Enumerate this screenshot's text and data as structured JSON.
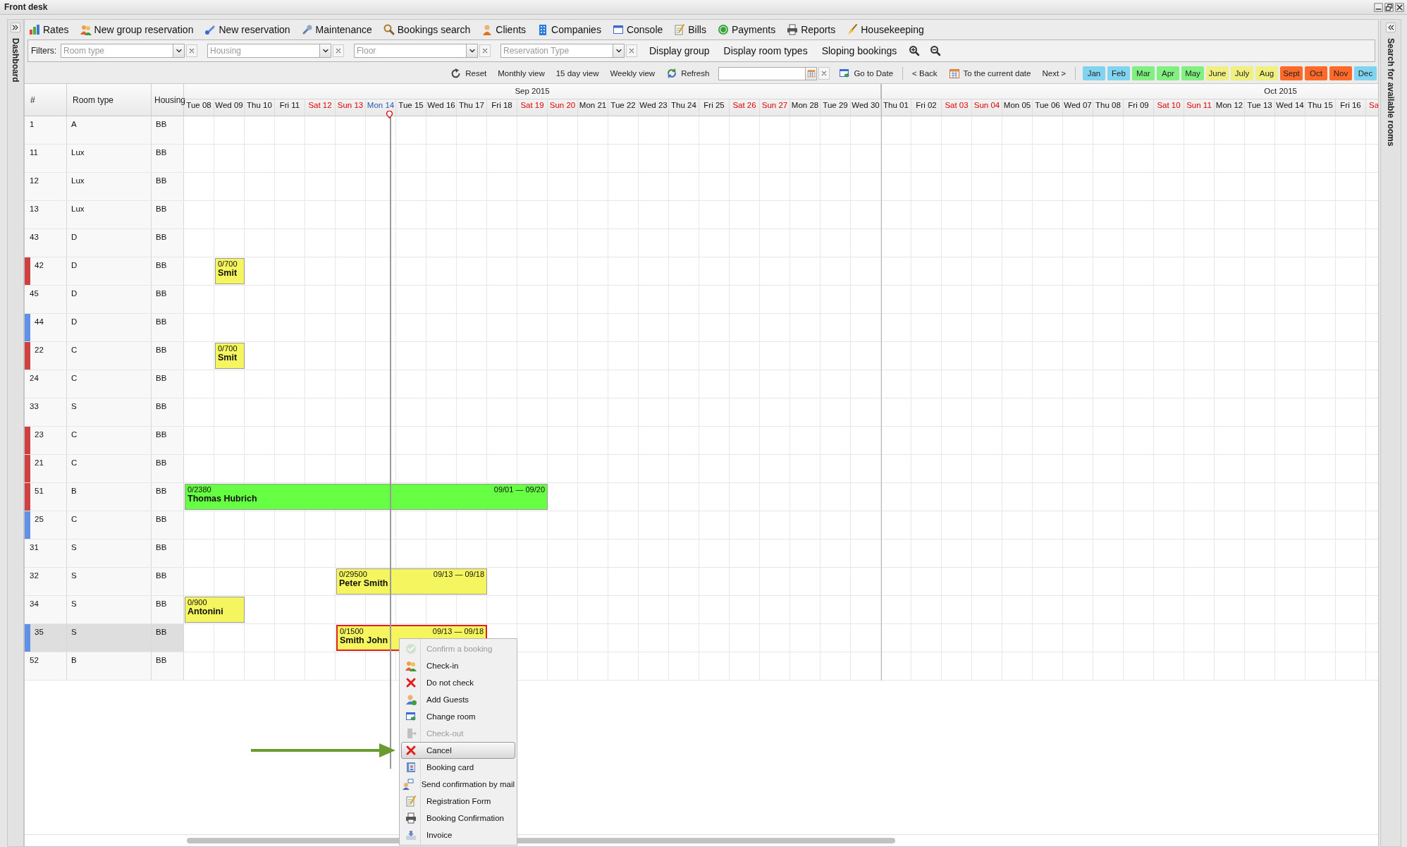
{
  "window": {
    "title": "Front desk"
  },
  "sidebars": {
    "left": {
      "label": "Dashboard"
    },
    "right": {
      "label": "Search for available rooms"
    }
  },
  "toolbar": [
    {
      "label": "Rates"
    },
    {
      "label": "New group reservation"
    },
    {
      "label": "New reservation"
    },
    {
      "label": "Maintenance"
    },
    {
      "label": "Bookings search"
    },
    {
      "label": "Clients"
    },
    {
      "label": "Companies"
    },
    {
      "label": "Console"
    },
    {
      "label": "Bills"
    },
    {
      "label": "Payments"
    },
    {
      "label": "Reports"
    },
    {
      "label": "Housekeeping"
    }
  ],
  "filters": {
    "label": "Filters:",
    "fields": [
      {
        "placeholder": "Room type"
      },
      {
        "placeholder": "Housing"
      },
      {
        "placeholder": "Floor"
      },
      {
        "placeholder": "Reservation Type"
      }
    ],
    "buttons": [
      "Display group",
      "Display room types",
      "Sloping bookings"
    ]
  },
  "nav": {
    "view_buttons": [
      "Reset",
      "Monthly view",
      "15 day view",
      "Weekly view",
      "Refresh"
    ],
    "go_to_date": "Go to Date",
    "back": "< Back",
    "current_date": "To the current date",
    "next": "Next >",
    "months": [
      {
        "label": "Jan",
        "color": "#80d4f0"
      },
      {
        "label": "Feb",
        "color": "#80d4f0"
      },
      {
        "label": "Mar",
        "color": "#80f080"
      },
      {
        "label": "Apr",
        "color": "#80f080"
      },
      {
        "label": "May",
        "color": "#80f080"
      },
      {
        "label": "June",
        "color": "#f0f080"
      },
      {
        "label": "July",
        "color": "#f0f080"
      },
      {
        "label": "Aug",
        "color": "#f0f080"
      },
      {
        "label": "Sept",
        "color": "#ff6a2a"
      },
      {
        "label": "Oct",
        "color": "#ff6a2a"
      },
      {
        "label": "Nov",
        "color": "#ff6a2a"
      },
      {
        "label": "Dec",
        "color": "#80d4f0"
      }
    ]
  },
  "grid": {
    "columns": [
      "#",
      "Room type",
      "Housing"
    ],
    "months": [
      {
        "label": "Sep 2015",
        "days": [
          {
            "label": "Tue 08",
            "kind": "weekday"
          },
          {
            "label": "Wed 09",
            "kind": "weekday"
          },
          {
            "label": "Thu 10",
            "kind": "weekday"
          },
          {
            "label": "Fri 11",
            "kind": "weekday"
          },
          {
            "label": "Sat 12",
            "kind": "weekend"
          },
          {
            "label": "Sun 13",
            "kind": "weekend"
          },
          {
            "label": "Mon 14",
            "kind": "today"
          },
          {
            "label": "Tue 15",
            "kind": "weekday"
          },
          {
            "label": "Wed 16",
            "kind": "weekday"
          },
          {
            "label": "Thu 17",
            "kind": "weekday"
          },
          {
            "label": "Fri 18",
            "kind": "weekday"
          },
          {
            "label": "Sat 19",
            "kind": "weekend"
          },
          {
            "label": "Sun 20",
            "kind": "weekend"
          },
          {
            "label": "Mon 21",
            "kind": "weekday"
          },
          {
            "label": "Tue 22",
            "kind": "weekday"
          },
          {
            "label": "Wed 23",
            "kind": "weekday"
          },
          {
            "label": "Thu 24",
            "kind": "weekday"
          },
          {
            "label": "Fri 25",
            "kind": "weekday"
          },
          {
            "label": "Sat 26",
            "kind": "weekend"
          },
          {
            "label": "Sun 27",
            "kind": "weekend"
          },
          {
            "label": "Mon 28",
            "kind": "weekday"
          },
          {
            "label": "Tue 29",
            "kind": "weekday"
          },
          {
            "label": "Wed 30",
            "kind": "weekday"
          }
        ]
      },
      {
        "label": "Oct 2015",
        "days": [
          {
            "label": "Thu 01",
            "kind": "weekday"
          },
          {
            "label": "Fri 02",
            "kind": "weekday"
          },
          {
            "label": "Sat 03",
            "kind": "weekend"
          },
          {
            "label": "Sun 04",
            "kind": "weekend"
          },
          {
            "label": "Mon 05",
            "kind": "weekday"
          },
          {
            "label": "Tue 06",
            "kind": "weekday"
          },
          {
            "label": "Wed 07",
            "kind": "weekday"
          },
          {
            "label": "Thu 08",
            "kind": "weekday"
          },
          {
            "label": "Fri 09",
            "kind": "weekday"
          },
          {
            "label": "Sat 10",
            "kind": "weekend"
          },
          {
            "label": "Sun 11",
            "kind": "weekend"
          },
          {
            "label": "Mon 12",
            "kind": "weekday"
          },
          {
            "label": "Tue 13",
            "kind": "weekday"
          },
          {
            "label": "Wed 14",
            "kind": "weekday"
          },
          {
            "label": "Thu 15",
            "kind": "weekday"
          },
          {
            "label": "Fri 16",
            "kind": "weekday"
          },
          {
            "label": "Sa",
            "kind": "weekend"
          }
        ]
      }
    ],
    "rows": [
      {
        "number": "1",
        "room_type": "A",
        "housing": "BB",
        "selected": false
      },
      {
        "number": "11",
        "room_type": "Lux",
        "housing": "BB",
        "selected": false
      },
      {
        "number": "12",
        "room_type": "Lux",
        "housing": "BB",
        "selected": false
      },
      {
        "number": "13",
        "room_type": "Lux",
        "housing": "BB",
        "selected": false
      },
      {
        "number": "43",
        "room_type": "D",
        "housing": "BB",
        "selected": false
      },
      {
        "number": "42",
        "room_type": "D",
        "housing": "BB",
        "color": "#d04040",
        "selected": false,
        "bookings": [
          {
            "amount": "0/700",
            "guest": "Smit",
            "color": "#f5f560",
            "selected": false
          }
        ]
      },
      {
        "number": "45",
        "room_type": "D",
        "housing": "BB",
        "selected": false
      },
      {
        "number": "44",
        "room_type": "D",
        "housing": "BB",
        "color": "#6090e8",
        "selected": false
      },
      {
        "number": "22",
        "room_type": "C",
        "housing": "BB",
        "color": "#d04040",
        "selected": false,
        "bookings": [
          {
            "amount": "0/700",
            "guest": "Smit",
            "color": "#f5f560",
            "selected": false
          }
        ]
      },
      {
        "number": "24",
        "room_type": "C",
        "housing": "BB",
        "selected": false
      },
      {
        "number": "33",
        "room_type": "S",
        "housing": "BB",
        "selected": false
      },
      {
        "number": "23",
        "room_type": "C",
        "housing": "BB",
        "color": "#d04040",
        "selected": false
      },
      {
        "number": "21",
        "room_type": "C",
        "housing": "BB",
        "color": "#d04040",
        "selected": false
      },
      {
        "number": "51",
        "room_type": "B",
        "housing": "BB",
        "color": "#d04040",
        "selected": false,
        "bookings": [
          {
            "amount": "0/2380",
            "guest": "Thomas Hubrich",
            "dates": "09/01 — 09/20",
            "color": "#66ff44",
            "selected": false
          }
        ]
      },
      {
        "number": "25",
        "room_type": "C",
        "housing": "BB",
        "color": "#6090e8",
        "selected": false
      },
      {
        "number": "31",
        "room_type": "S",
        "housing": "BB",
        "selected": false
      },
      {
        "number": "32",
        "room_type": "S",
        "housing": "BB",
        "selected": false,
        "bookings": [
          {
            "amount": "0/29500",
            "guest": "Peter Smith",
            "dates": "09/13 — 09/18",
            "color": "#f5f560",
            "selected": false
          }
        ]
      },
      {
        "number": "34",
        "room_type": "S",
        "housing": "BB",
        "selected": false,
        "bookings": [
          {
            "amount": "0/900",
            "guest": "Antonini",
            "color": "#f5f560",
            "selected": false
          }
        ]
      },
      {
        "number": "35",
        "room_type": "S",
        "housing": "BB",
        "color": "#6090e8",
        "selected": true,
        "bookings": [
          {
            "amount": "0/1500",
            "guest": "Smith John",
            "dates": "09/13 — 09/18",
            "color": "#f5f560",
            "selected": true
          }
        ]
      },
      {
        "number": "52",
        "room_type": "B",
        "housing": "BB",
        "selected": false
      }
    ]
  },
  "context_menu": {
    "items": [
      {
        "label": "Confirm a booking",
        "disabled": true,
        "selected": false
      },
      {
        "label": "Check-in",
        "disabled": false,
        "selected": false
      },
      {
        "label": "Do not check",
        "disabled": false,
        "selected": false
      },
      {
        "label": "Add Guests",
        "disabled": false,
        "selected": false
      },
      {
        "label": "Change room",
        "disabled": false,
        "selected": false
      },
      {
        "label": "Check-out",
        "disabled": true,
        "selected": false
      },
      {
        "label": "Cancel",
        "disabled": false,
        "selected": true
      },
      {
        "label": "Booking card",
        "disabled": false,
        "selected": false
      },
      {
        "label": "Send confirmation by mail",
        "disabled": false,
        "selected": false
      },
      {
        "label": "Registration Form",
        "disabled": false,
        "selected": false
      },
      {
        "label": "Booking Confirmation",
        "disabled": false,
        "selected": false
      },
      {
        "label": "Invoice",
        "disabled": false,
        "selected": false
      }
    ]
  }
}
